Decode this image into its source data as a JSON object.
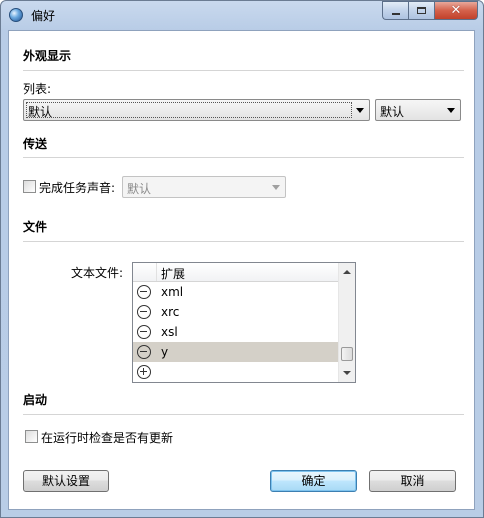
{
  "window": {
    "title": "偏好"
  },
  "appearance": {
    "section_title": "外观显示",
    "list_label": "列表:",
    "list_value": "默认",
    "style_value": "默认"
  },
  "transfer": {
    "section_title": "传送",
    "sound_label": "完成任务声音:",
    "sound_checked": false,
    "sound_value": "默认"
  },
  "files": {
    "section_title": "文件",
    "text_files_label": "文本文件:",
    "column_header": "扩展",
    "items": [
      {
        "label": "xml"
      },
      {
        "label": "xrc"
      },
      {
        "label": "xsl"
      },
      {
        "label": "y",
        "selected": true
      }
    ]
  },
  "startup": {
    "section_title": "启动",
    "check_updates_label": "在运行时检查是否有更新",
    "check_updates_checked": false
  },
  "buttons": {
    "defaults": "默认设置",
    "ok": "确定",
    "cancel": "取消"
  }
}
